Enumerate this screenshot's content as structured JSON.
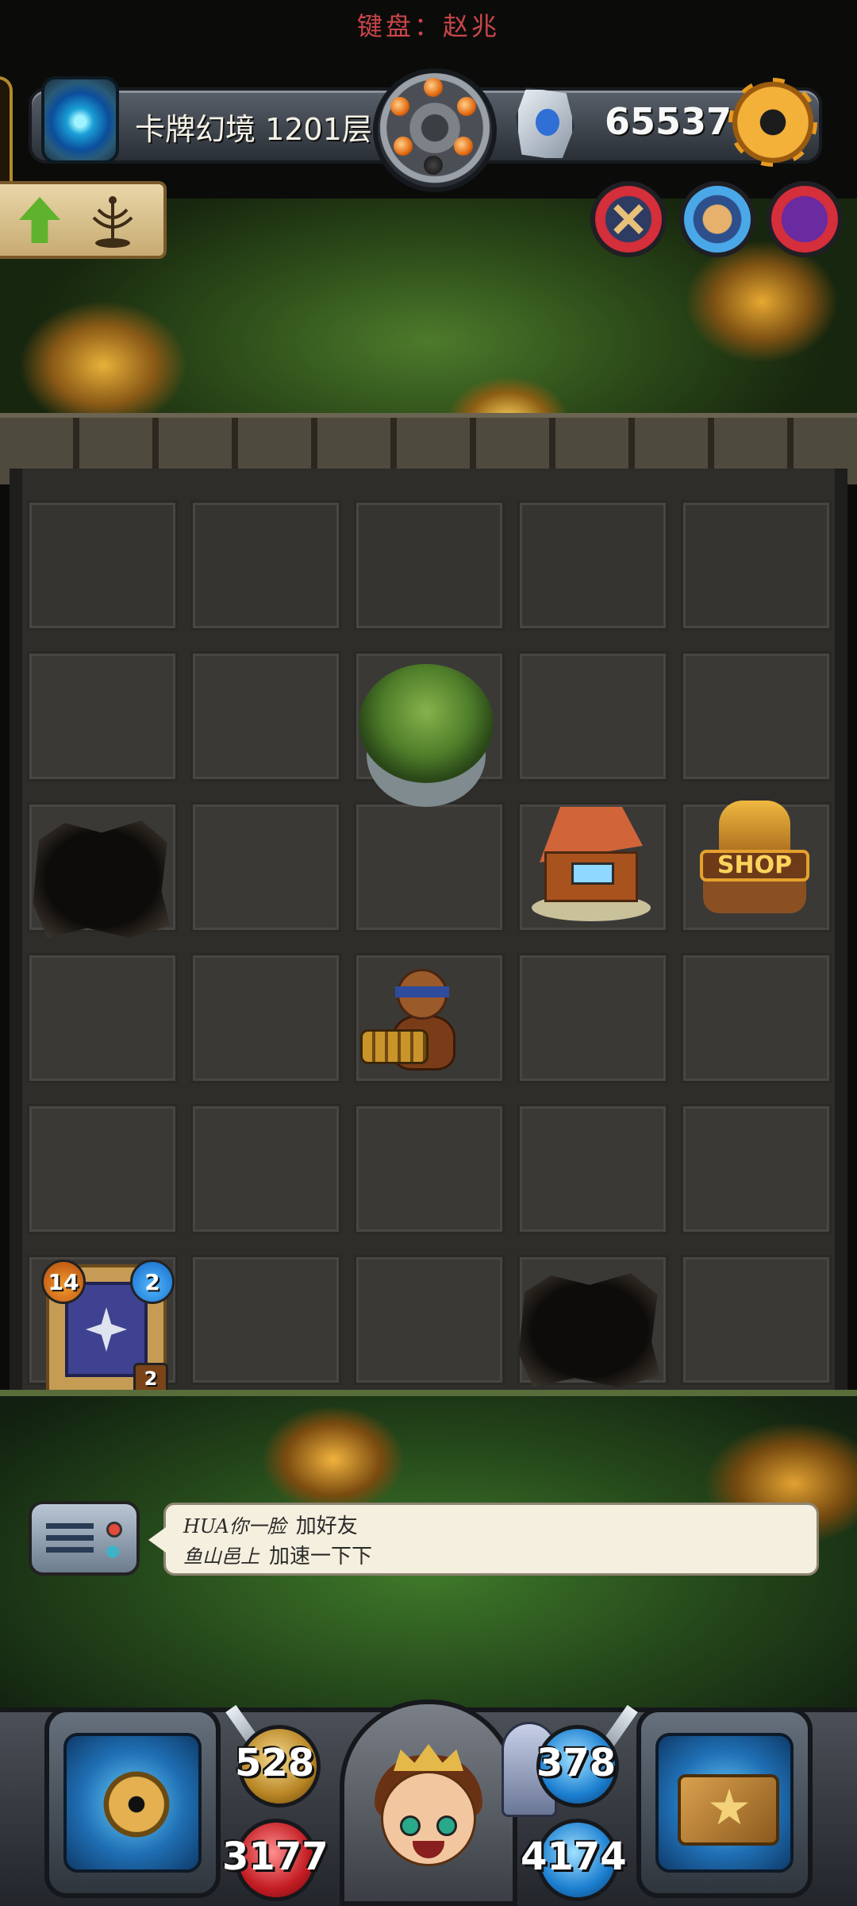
{
  "keyboard_note": "键盘：赵兆",
  "topbar": {
    "realm_icon": "portal-vortex-icon",
    "realm_label": "卡牌幻境 1201层",
    "center_icon": "turret-wheel-icon",
    "currency_icon": "crystal-shard-icon",
    "currency_value": "65537",
    "settings_icon": "gear-icon"
  },
  "quest_panel": {
    "arrow_icon": "up-arrow-icon",
    "item_icon": "candelabra-icon"
  },
  "round_buttons": [
    {
      "icon": "crossed-hammers-icon",
      "accent": "#d42f3a"
    },
    {
      "icon": "hero-portrait-icon",
      "accent": "#4aa8e8"
    },
    {
      "icon": "monster-portrait-icon",
      "accent": "#d42f3a"
    }
  ],
  "board": {
    "rows": 6,
    "cols": 5,
    "objects": [
      {
        "type": "bush",
        "row": 2,
        "col": 3
      },
      {
        "type": "hole",
        "row": 3,
        "col": 1
      },
      {
        "type": "house",
        "row": 3,
        "col": 4
      },
      {
        "type": "shop",
        "row": 3,
        "col": 5,
        "label": "SHOP"
      },
      {
        "type": "hero-gunner",
        "row": 4,
        "col": 3
      },
      {
        "type": "card",
        "row": 6,
        "col": 1
      },
      {
        "type": "hole",
        "row": 6,
        "col": 4
      }
    ]
  },
  "card": {
    "attack": "14",
    "cost": "2",
    "stack": "2",
    "icon": "shuriken-card-icon"
  },
  "chat": {
    "icon": "radio-chat-icon",
    "lines": [
      {
        "name": "HUA你一脸",
        "text": "加好友"
      },
      {
        "name": "鱼山邑上",
        "text": "加速一下下"
      }
    ]
  },
  "hud": {
    "left_slot_icon": "golden-compass-icon",
    "right_slot_icon": "magic-tome-icon",
    "portrait_icon": "hero-princess-icon",
    "attack": "528",
    "health": "3177",
    "defense": "378",
    "mana": "4174"
  },
  "colors": {
    "accent_gold": "#f3b13a",
    "board_tile": "#3a3936",
    "chat_bg": "#f4efde"
  }
}
